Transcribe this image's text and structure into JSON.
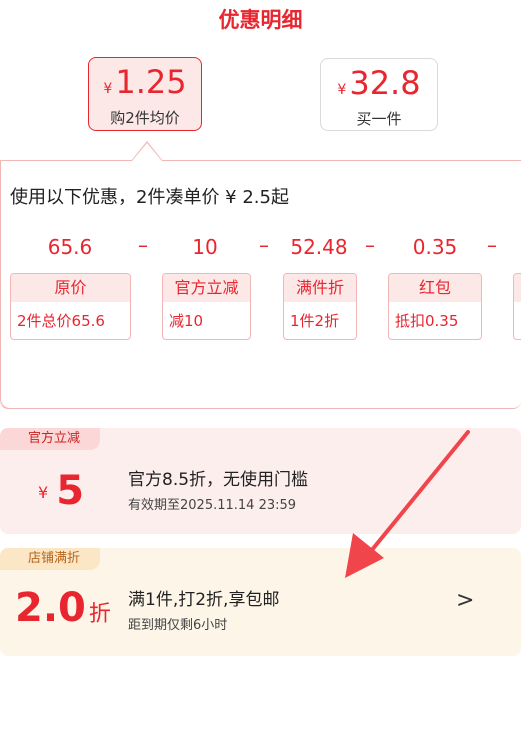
{
  "title": "优惠明细",
  "tabs": [
    {
      "currency": "¥",
      "price": "1.25",
      "label": "购2件均价",
      "selected": true
    },
    {
      "currency": "¥",
      "price": "32.8",
      "label": "买一件",
      "selected": false
    }
  ],
  "panel": {
    "summary": "使用以下优惠，2件凑单价 ¥ 2.5起",
    "values": [
      "65.6",
      "10",
      "52.48",
      "0.35"
    ],
    "operator": "–",
    "chips": [
      {
        "head": "原价",
        "body": "2件总价65.6"
      },
      {
        "head": "官方立减",
        "body": "减10"
      },
      {
        "head": "满件折",
        "body": "1件2折"
      },
      {
        "head": "红包",
        "body": "抵扣0.35"
      }
    ]
  },
  "coupons": [
    {
      "badge": "官方立减",
      "currency": "¥",
      "amount": "5",
      "description": "官方8.5折，无使用门槛",
      "note": "有效期至2025.11.14 23:59"
    },
    {
      "badge": "店铺满折",
      "amount": "2.0",
      "unit": "折",
      "description": "满1件,打2折,享包邮",
      "note": "距到期仅剩6小时",
      "chevron": ">"
    }
  ],
  "colors": {
    "accent": "#e8262f",
    "card_red_bg": "#fdeeee",
    "card_orange_bg": "#fdf6e8"
  }
}
